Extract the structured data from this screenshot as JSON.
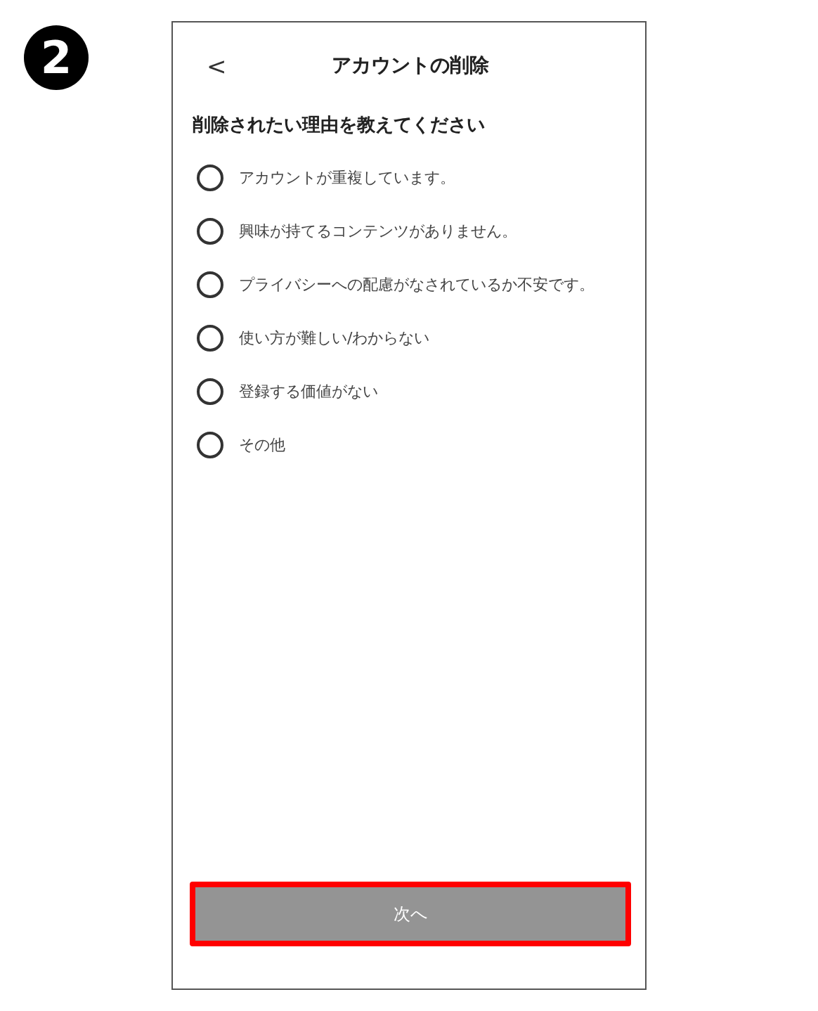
{
  "step": "2",
  "header": {
    "back": "<",
    "title": "アカウントの削除"
  },
  "question": "削除されたい理由を教えてください",
  "reasons": [
    {
      "label": "アカウントが重複しています。",
      "selected": false
    },
    {
      "label": "興味が持てるコンテンツがありません。",
      "selected": false
    },
    {
      "label": "プライバシーへの配慮がなされているか不安です。",
      "selected": false
    },
    {
      "label": "使い方が難しい/わからない",
      "selected": false
    },
    {
      "label": "登録する価値がない",
      "selected": false
    },
    {
      "label": "その他",
      "selected": false
    }
  ],
  "next_button": {
    "label": "次へ",
    "disabled": true,
    "highlighted": true
  }
}
